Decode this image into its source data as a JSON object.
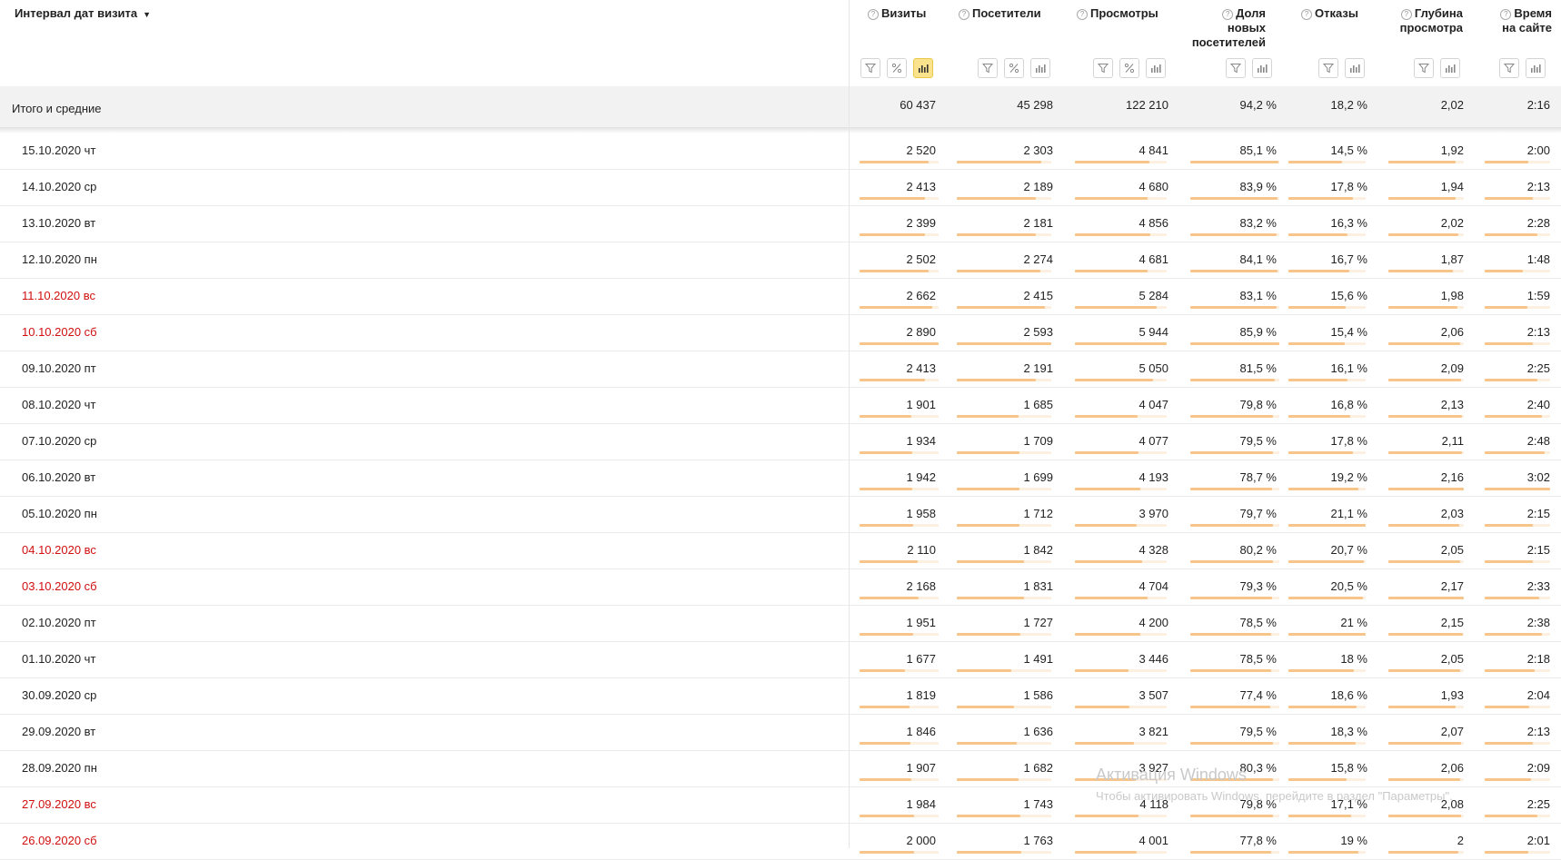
{
  "dimension": {
    "title": "Интервал дат визита",
    "sort_arrow": "▼"
  },
  "columns": [
    {
      "label": [
        "Визиты"
      ],
      "tools": [
        "filter",
        "percent",
        "chart"
      ],
      "active_tool": "chart"
    },
    {
      "label": [
        "Посетители"
      ],
      "tools": [
        "filter",
        "percent",
        "chart"
      ],
      "active_tool": ""
    },
    {
      "label": [
        "Просмотры"
      ],
      "tools": [
        "filter",
        "percent",
        "chart"
      ],
      "active_tool": ""
    },
    {
      "label": [
        "Доля",
        "новых",
        "посетителей"
      ],
      "tools": [
        "filter",
        "chart"
      ],
      "active_tool": ""
    },
    {
      "label": [
        "Отказы"
      ],
      "tools": [
        "filter",
        "chart"
      ],
      "active_tool": ""
    },
    {
      "label": [
        "Глубина",
        "просмотра"
      ],
      "tools": [
        "filter",
        "chart"
      ],
      "active_tool": ""
    },
    {
      "label": [
        "Время",
        "на сайте"
      ],
      "tools": [
        "filter",
        "chart"
      ],
      "active_tool": ""
    }
  ],
  "totals": {
    "label": "Итого и средние",
    "values": [
      "60 437",
      "45 298",
      "122 210",
      "94,2 %",
      "18,2 %",
      "2,02",
      "2:16"
    ]
  },
  "rows": [
    {
      "date": "15.10.2020 чт",
      "weekend": false,
      "values": [
        "2 520",
        "2 303",
        "4 841",
        "85,1 %",
        "14,5 %",
        "1,92",
        "2:00"
      ],
      "bars": [
        0.87,
        0.89,
        0.81,
        0.99,
        0.69,
        0.89,
        0.66
      ]
    },
    {
      "date": "14.10.2020 ср",
      "weekend": false,
      "values": [
        "2 413",
        "2 189",
        "4 680",
        "83,9 %",
        "17,8 %",
        "1,94",
        "2:13"
      ],
      "bars": [
        0.83,
        0.84,
        0.79,
        0.98,
        0.84,
        0.89,
        0.73
      ]
    },
    {
      "date": "13.10.2020 вт",
      "weekend": false,
      "values": [
        "2 399",
        "2 181",
        "4 856",
        "83,2 %",
        "16,3 %",
        "2,02",
        "2:28"
      ],
      "bars": [
        0.83,
        0.84,
        0.82,
        0.97,
        0.77,
        0.93,
        0.81
      ]
    },
    {
      "date": "12.10.2020 пн",
      "weekend": false,
      "values": [
        "2 502",
        "2 274",
        "4 681",
        "84,1 %",
        "16,7 %",
        "1,87",
        "1:48"
      ],
      "bars": [
        0.87,
        0.88,
        0.79,
        0.98,
        0.79,
        0.86,
        0.59
      ]
    },
    {
      "date": "11.10.2020 вс",
      "weekend": true,
      "values": [
        "2 662",
        "2 415",
        "5 284",
        "83,1 %",
        "15,6 %",
        "1,98",
        "1:59"
      ],
      "bars": [
        0.92,
        0.93,
        0.89,
        0.97,
        0.74,
        0.91,
        0.65
      ]
    },
    {
      "date": "10.10.2020 сб",
      "weekend": true,
      "values": [
        "2 890",
        "2 593",
        "5 944",
        "85,9 %",
        "15,4 %",
        "2,06",
        "2:13"
      ],
      "bars": [
        1.0,
        1.0,
        1.0,
        1.0,
        0.73,
        0.95,
        0.73
      ]
    },
    {
      "date": "09.10.2020 пт",
      "weekend": false,
      "values": [
        "2 413",
        "2 191",
        "5 050",
        "81,5 %",
        "16,1 %",
        "2,09",
        "2:25"
      ],
      "bars": [
        0.83,
        0.84,
        0.85,
        0.95,
        0.76,
        0.96,
        0.8
      ]
    },
    {
      "date": "08.10.2020 чт",
      "weekend": false,
      "values": [
        "1 901",
        "1 685",
        "4 047",
        "79,8 %",
        "16,8 %",
        "2,13",
        "2:40"
      ],
      "bars": [
        0.66,
        0.65,
        0.68,
        0.93,
        0.8,
        0.98,
        0.88
      ]
    },
    {
      "date": "07.10.2020 ср",
      "weekend": false,
      "values": [
        "1 934",
        "1 709",
        "4 077",
        "79,5 %",
        "17,8 %",
        "2,11",
        "2:48"
      ],
      "bars": [
        0.67,
        0.66,
        0.69,
        0.93,
        0.84,
        0.97,
        0.92
      ]
    },
    {
      "date": "06.10.2020 вт",
      "weekend": false,
      "values": [
        "1 942",
        "1 699",
        "4 193",
        "78,7 %",
        "19,2 %",
        "2,16",
        "3:02"
      ],
      "bars": [
        0.67,
        0.66,
        0.71,
        0.92,
        0.91,
        1.0,
        1.0
      ]
    },
    {
      "date": "05.10.2020 пн",
      "weekend": false,
      "values": [
        "1 958",
        "1 712",
        "3 970",
        "79,7 %",
        "21,1 %",
        "2,03",
        "2:15"
      ],
      "bars": [
        0.68,
        0.66,
        0.67,
        0.93,
        1.0,
        0.94,
        0.74
      ]
    },
    {
      "date": "04.10.2020 вс",
      "weekend": true,
      "values": [
        "2 110",
        "1 842",
        "4 328",
        "80,2 %",
        "20,7 %",
        "2,05",
        "2:15"
      ],
      "bars": [
        0.73,
        0.71,
        0.73,
        0.93,
        0.98,
        0.95,
        0.74
      ]
    },
    {
      "date": "03.10.2020 сб",
      "weekend": true,
      "values": [
        "2 168",
        "1 831",
        "4 704",
        "79,3 %",
        "20,5 %",
        "2,17",
        "2:33"
      ],
      "bars": [
        0.75,
        0.71,
        0.79,
        0.92,
        0.97,
        1.0,
        0.84
      ]
    },
    {
      "date": "02.10.2020 пт",
      "weekend": false,
      "values": [
        "1 951",
        "1 727",
        "4 200",
        "78,5 %",
        "21 %",
        "2,15",
        "2:38"
      ],
      "bars": [
        0.68,
        0.67,
        0.71,
        0.91,
        1.0,
        0.99,
        0.87
      ]
    },
    {
      "date": "01.10.2020 чт",
      "weekend": false,
      "values": [
        "1 677",
        "1 491",
        "3 446",
        "78,5 %",
        "18 %",
        "2,05",
        "2:18"
      ],
      "bars": [
        0.58,
        0.58,
        0.58,
        0.91,
        0.85,
        0.95,
        0.76
      ]
    },
    {
      "date": "30.09.2020 ср",
      "weekend": false,
      "values": [
        "1 819",
        "1 586",
        "3 507",
        "77,4 %",
        "18,6 %",
        "1,93",
        "2:04"
      ],
      "bars": [
        0.63,
        0.61,
        0.59,
        0.9,
        0.88,
        0.89,
        0.68
      ]
    },
    {
      "date": "29.09.2020 вт",
      "weekend": false,
      "values": [
        "1 846",
        "1 636",
        "3 821",
        "79,5 %",
        "18,3 %",
        "2,07",
        "2:13"
      ],
      "bars": [
        0.64,
        0.63,
        0.64,
        0.93,
        0.87,
        0.96,
        0.73
      ]
    },
    {
      "date": "28.09.2020 пн",
      "weekend": false,
      "values": [
        "1 907",
        "1 682",
        "3 927",
        "80,3 %",
        "15,8 %",
        "2,06",
        "2:09"
      ],
      "bars": [
        0.66,
        0.65,
        0.66,
        0.93,
        0.75,
        0.95,
        0.71
      ]
    },
    {
      "date": "27.09.2020 вс",
      "weekend": true,
      "values": [
        "1 984",
        "1 743",
        "4 118",
        "79,8 %",
        "17,1 %",
        "2,08",
        "2:25"
      ],
      "bars": [
        0.69,
        0.67,
        0.69,
        0.93,
        0.81,
        0.96,
        0.8
      ]
    },
    {
      "date": "26.09.2020 сб",
      "weekend": true,
      "values": [
        "2 000",
        "1 763",
        "4 001",
        "77,8 %",
        "19 %",
        "2",
        "2:01"
      ],
      "bars": [
        0.69,
        0.68,
        0.67,
        0.91,
        0.9,
        0.93,
        0.66
      ]
    }
  ],
  "watermark": {
    "title": "Активация Windows",
    "text": "Чтобы активировать Windows, перейдите в раздел \"Параметры\"."
  }
}
